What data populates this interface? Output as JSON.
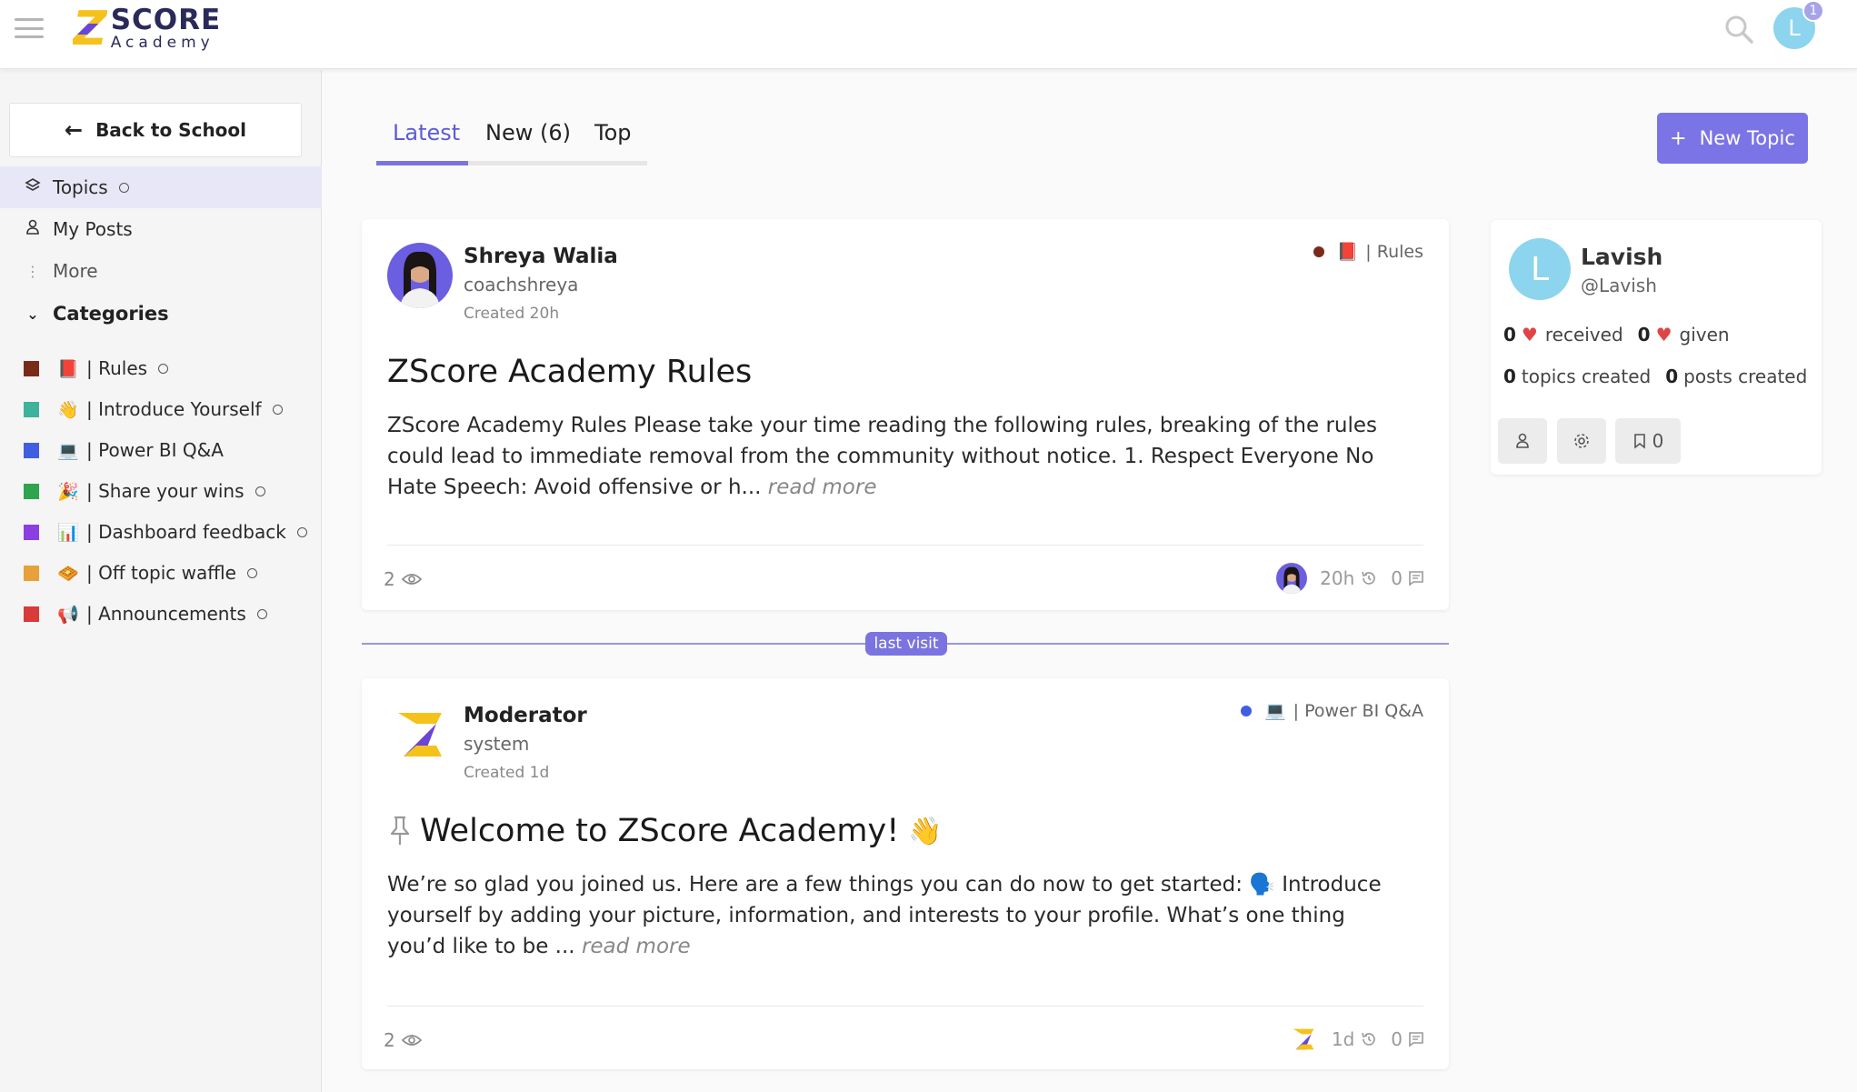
{
  "header": {
    "logo_letter": "Z",
    "logo_main": "SCORE",
    "logo_sub": "Academy",
    "notification_count": "1",
    "user_initial": "L"
  },
  "sidebar": {
    "back_label": "Back to School",
    "nav": [
      {
        "label": "Topics",
        "icon": "layers-icon"
      },
      {
        "label": "My Posts",
        "icon": "user-icon"
      },
      {
        "label": "More",
        "icon": "more-icon"
      }
    ],
    "categories_label": "Categories",
    "categories": [
      {
        "label": "| Rules",
        "emoji": "📕",
        "color": "#7a2a1a"
      },
      {
        "label": "| Introduce Yourself",
        "emoji": "👋",
        "color": "#3cb39a"
      },
      {
        "label": "| Power BI Q&A",
        "emoji": "💻",
        "color": "#3f5fe0"
      },
      {
        "label": "| Share your wins",
        "emoji": "🎉",
        "color": "#2ea44f"
      },
      {
        "label": "| Dashboard feedback",
        "emoji": "📊",
        "color": "#8b3fe0"
      },
      {
        "label": "| Off topic waffle",
        "emoji": "🧇",
        "color": "#e8a13a"
      },
      {
        "label": "| Announcements",
        "emoji": "📢",
        "color": "#d93a3a"
      }
    ]
  },
  "tabs": [
    {
      "label": "Latest"
    },
    {
      "label": "New (6)"
    },
    {
      "label": "Top"
    }
  ],
  "new_topic_label": "New Topic",
  "last_visit_label": "last visit",
  "posts": [
    {
      "author": "Shreya Walia",
      "username": "coachshreya",
      "created": "Created 20h",
      "category": "| Rules",
      "category_emoji": "📕",
      "category_color": "#7a2a1a",
      "title": "ZScore Academy Rules",
      "excerpt": "ZScore Academy Rules Please take your time reading the following rules, breaking of the rules could lead to immediate removal from the community without notice. 1. Respect Everyone No Hate Speech: Avoid offensive or h...",
      "read_more": "read more",
      "views": "2",
      "activity": "20h",
      "replies": "0"
    },
    {
      "author": "Moderator",
      "username": "system",
      "created": "Created 1d",
      "category": "| Power BI Q&A",
      "category_emoji": "💻",
      "category_color": "#3f5fe0",
      "title": "Welcome to ZScore Academy!",
      "title_emoji": "👋",
      "excerpt": "We’re so glad you joined us. Here are a few things you can do now to get started: 🗣️ Introduce your­self by adding your picture, information, and interests to your profile. What’s one thing you’d like to be ...",
      "read_more": "read more",
      "views": "2",
      "activity": "1d",
      "replies": "0"
    }
  ],
  "profile": {
    "initial": "L",
    "name": "Lavish",
    "handle": "@Lavish",
    "likes_received": "0",
    "received_label": "received",
    "likes_given": "0",
    "given_label": "given",
    "topics_created": "0",
    "topics_label": "topics created",
    "posts_created": "0",
    "posts_label": "posts created",
    "bookmarks": "0"
  }
}
